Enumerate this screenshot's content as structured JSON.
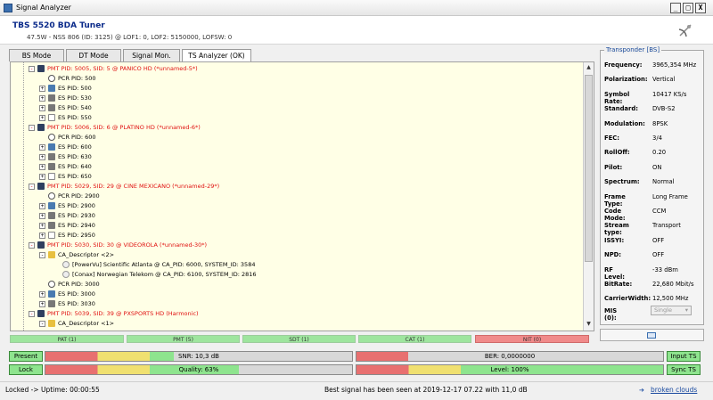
{
  "window": {
    "title": "Signal Analyzer",
    "min": "_",
    "max": "□",
    "close": "X"
  },
  "header": {
    "tuner": "TBS 5520 BDA Tuner",
    "sub": "47.5W - NSS 806 (ID: 3125) @ LOF1: 0, LOF2: 5150000, LOFSW: 0"
  },
  "tabs": [
    "BS Mode",
    "DT Mode",
    "Signal Mon.",
    "TS Analyzer (OK)"
  ],
  "tree": [
    {
      "text": "PMT PID: 5005, SID: 5 @ PANICO HD (*unnamed-5*)",
      "kind": "pmt",
      "level": 0,
      "exp": "-"
    },
    {
      "text": "PCR PID: 500",
      "kind": "pcr",
      "level": 1,
      "exp": ""
    },
    {
      "text": "ES PID: 500",
      "kind": "video",
      "level": 1,
      "exp": "+"
    },
    {
      "text": "ES PID: 530",
      "kind": "audio",
      "level": 1,
      "exp": "+"
    },
    {
      "text": "ES PID: 540",
      "kind": "audio",
      "level": 1,
      "exp": "+"
    },
    {
      "text": "ES PID: 550",
      "kind": "unk",
      "level": 1,
      "exp": "+"
    },
    {
      "text": "PMT PID: 5006, SID: 6 @ PLATINO HD (*unnamed-6*)",
      "kind": "pmt",
      "level": 0,
      "exp": "-"
    },
    {
      "text": "PCR PID: 600",
      "kind": "pcr",
      "level": 1,
      "exp": ""
    },
    {
      "text": "ES PID: 600",
      "kind": "video",
      "level": 1,
      "exp": "+"
    },
    {
      "text": "ES PID: 630",
      "kind": "audio",
      "level": 1,
      "exp": "+"
    },
    {
      "text": "ES PID: 640",
      "kind": "audio",
      "level": 1,
      "exp": "+"
    },
    {
      "text": "ES PID: 650",
      "kind": "unk",
      "level": 1,
      "exp": "+"
    },
    {
      "text": "PMT PID: 5029, SID: 29 @ CINE MEXICANO (*unnamed-29*)",
      "kind": "pmt",
      "level": 0,
      "exp": "-"
    },
    {
      "text": "PCR PID: 2900",
      "kind": "pcr",
      "level": 1,
      "exp": ""
    },
    {
      "text": "ES PID: 2900",
      "kind": "video",
      "level": 1,
      "exp": "+"
    },
    {
      "text": "ES PID: 2930",
      "kind": "audio",
      "level": 1,
      "exp": "+"
    },
    {
      "text": "ES PID: 2940",
      "kind": "audio",
      "level": 1,
      "exp": "+"
    },
    {
      "text": "ES PID: 2950",
      "kind": "unk",
      "level": 1,
      "exp": "+"
    },
    {
      "text": "PMT PID: 5030, SID: 30 @ VIDEOROLA (*unnamed-30*)",
      "kind": "pmt",
      "level": 0,
      "exp": "-"
    },
    {
      "text": "CA_Descriptor <2>",
      "kind": "lock",
      "level": 1,
      "exp": "-"
    },
    {
      "text": "[PowerVu] Scientific Atlanta @ CA_PID: 6000, SYSTEM_ID: 3584",
      "kind": "desc",
      "level": 2,
      "exp": ""
    },
    {
      "text": "[Conax] Norwegian Telekom @ CA_PID: 6100, SYSTEM_ID: 2816",
      "kind": "desc",
      "level": 2,
      "exp": ""
    },
    {
      "text": "PCR PID: 3000",
      "kind": "pcr",
      "level": 1,
      "exp": ""
    },
    {
      "text": "ES PID: 3000",
      "kind": "video",
      "level": 1,
      "exp": "+"
    },
    {
      "text": "ES PID: 3030",
      "kind": "audio",
      "level": 1,
      "exp": "+"
    },
    {
      "text": "PMT PID: 5039, SID: 39 @ PXSPORTS HD (Harmonic)",
      "kind": "pmt",
      "level": 0,
      "exp": "-"
    },
    {
      "text": "CA_Descriptor <1>",
      "kind": "lock",
      "level": 1,
      "exp": "-"
    }
  ],
  "transponder": {
    "legend": "Transponder [BS]",
    "rows": [
      {
        "k": "Frequency:",
        "v": "3965,354 MHz"
      },
      {
        "k": "Polarization:",
        "v": "Vertical"
      },
      {
        "k": "Symbol Rate:",
        "v": "10417 KS/s"
      },
      {
        "k": "Standard:",
        "v": "DVB-S2"
      },
      {
        "k": "Modulation:",
        "v": "8PSK"
      },
      {
        "k": "FEC:",
        "v": "3/4"
      },
      {
        "k": "RollOff:",
        "v": "0.20"
      },
      {
        "k": "Pilot:",
        "v": "ON"
      },
      {
        "k": "Spectrum:",
        "v": "Normal"
      },
      {
        "k": "Frame Type:",
        "v": "Long Frame"
      },
      {
        "k": "Code Mode:",
        "v": "CCM"
      },
      {
        "k": "Stream type:",
        "v": "Transport"
      },
      {
        "k": "ISSYI:",
        "v": "OFF"
      },
      {
        "k": "NPD:",
        "v": "OFF"
      },
      {
        "k": "RF Level:",
        "v": "-33 dBm"
      },
      {
        "k": "BitRate:",
        "v": "22,680 Mbit/s"
      },
      {
        "k": "CarrierWidth:",
        "v": "12,500 MHz"
      }
    ],
    "mis_label": "MIS (0):",
    "mis_value": "Single"
  },
  "tables": [
    "PAT (1)",
    "PMT (5)",
    "SDT (1)",
    "CAT (1)",
    "NIT (0)"
  ],
  "buttons": {
    "present": "Present",
    "lock": "Lock",
    "input_ts": "Input TS",
    "sync_ts": "Sync TS"
  },
  "meters": {
    "snr": {
      "label": "SNR: 10,3 dB",
      "level": 0.42
    },
    "quality": {
      "label": "Quality: 63%",
      "level": 0.63
    },
    "ber": {
      "label": "BER: 0,0000000",
      "level": 0.0
    },
    "level": {
      "label": "Level: 100%",
      "level": 1.0
    }
  },
  "status": {
    "uptime": "Locked -> Uptime: 00:00:55",
    "best": "Best signal has been seen at 2019-12-17 07.22 with 11,0 dB",
    "link": "broken clouds"
  }
}
